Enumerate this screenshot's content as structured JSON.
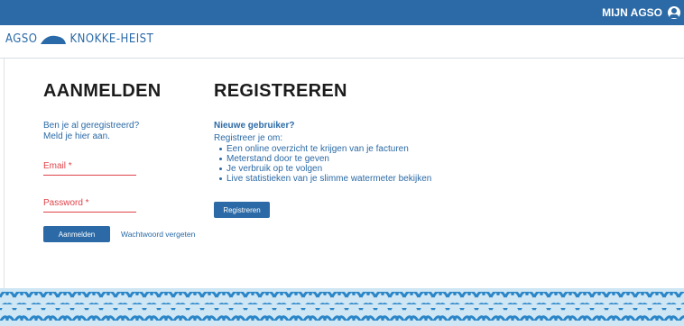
{
  "header": {
    "account_label": "MIJN AGSO",
    "account_icon": "user-icon"
  },
  "logo": {
    "left_text": "AGSO",
    "right_text": "KNOKKE-HEIST"
  },
  "login": {
    "title": "AANMELDEN",
    "intro_line1": "Ben je al geregistreerd?",
    "intro_line2": "Meld je hier aan.",
    "email_label": "Email *",
    "password_label": "Password *",
    "submit_label": "Aanmelden",
    "forgot_label": "Wachtwoord vergeten"
  },
  "register": {
    "title": "REGISTREREN",
    "new_user_label": "Nieuwe gebruiker?",
    "intro": "Registreer je om:",
    "benefits": [
      "Een online overzicht te krijgen van je facturen",
      "Meterstand door te geven",
      "Je verbruik op te volgen",
      "Live statistieken van je slimme watermeter bekijken"
    ],
    "submit_label": "Registreren"
  },
  "colors": {
    "brand_blue": "#2b6aa6",
    "required_red": "#e0434a",
    "wave_light": "#cfe6f4"
  }
}
